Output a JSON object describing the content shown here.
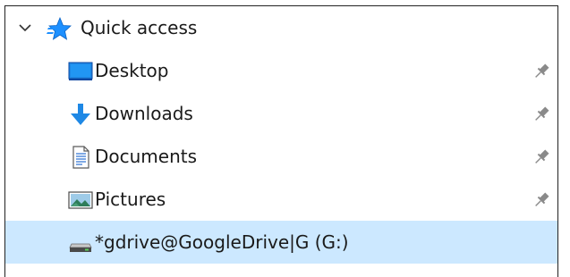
{
  "quick_access": {
    "label": "Quick access",
    "expanded": true,
    "icon": "star-icon",
    "accent": "#1e90ff"
  },
  "items": [
    {
      "label": "Desktop",
      "icon": "desktop-icon",
      "pinned": true
    },
    {
      "label": "Downloads",
      "icon": "download-arrow-icon",
      "pinned": true
    },
    {
      "label": "Documents",
      "icon": "document-icon",
      "pinned": true
    },
    {
      "label": "Pictures",
      "icon": "pictures-icon",
      "pinned": true
    },
    {
      "label": "*gdrive@GoogleDrive|G (G:)",
      "icon": "drive-icon",
      "pinned": false,
      "selected": true
    }
  ],
  "colors": {
    "selection_bg": "#cce8ff",
    "pin": "#7a7a7a"
  }
}
